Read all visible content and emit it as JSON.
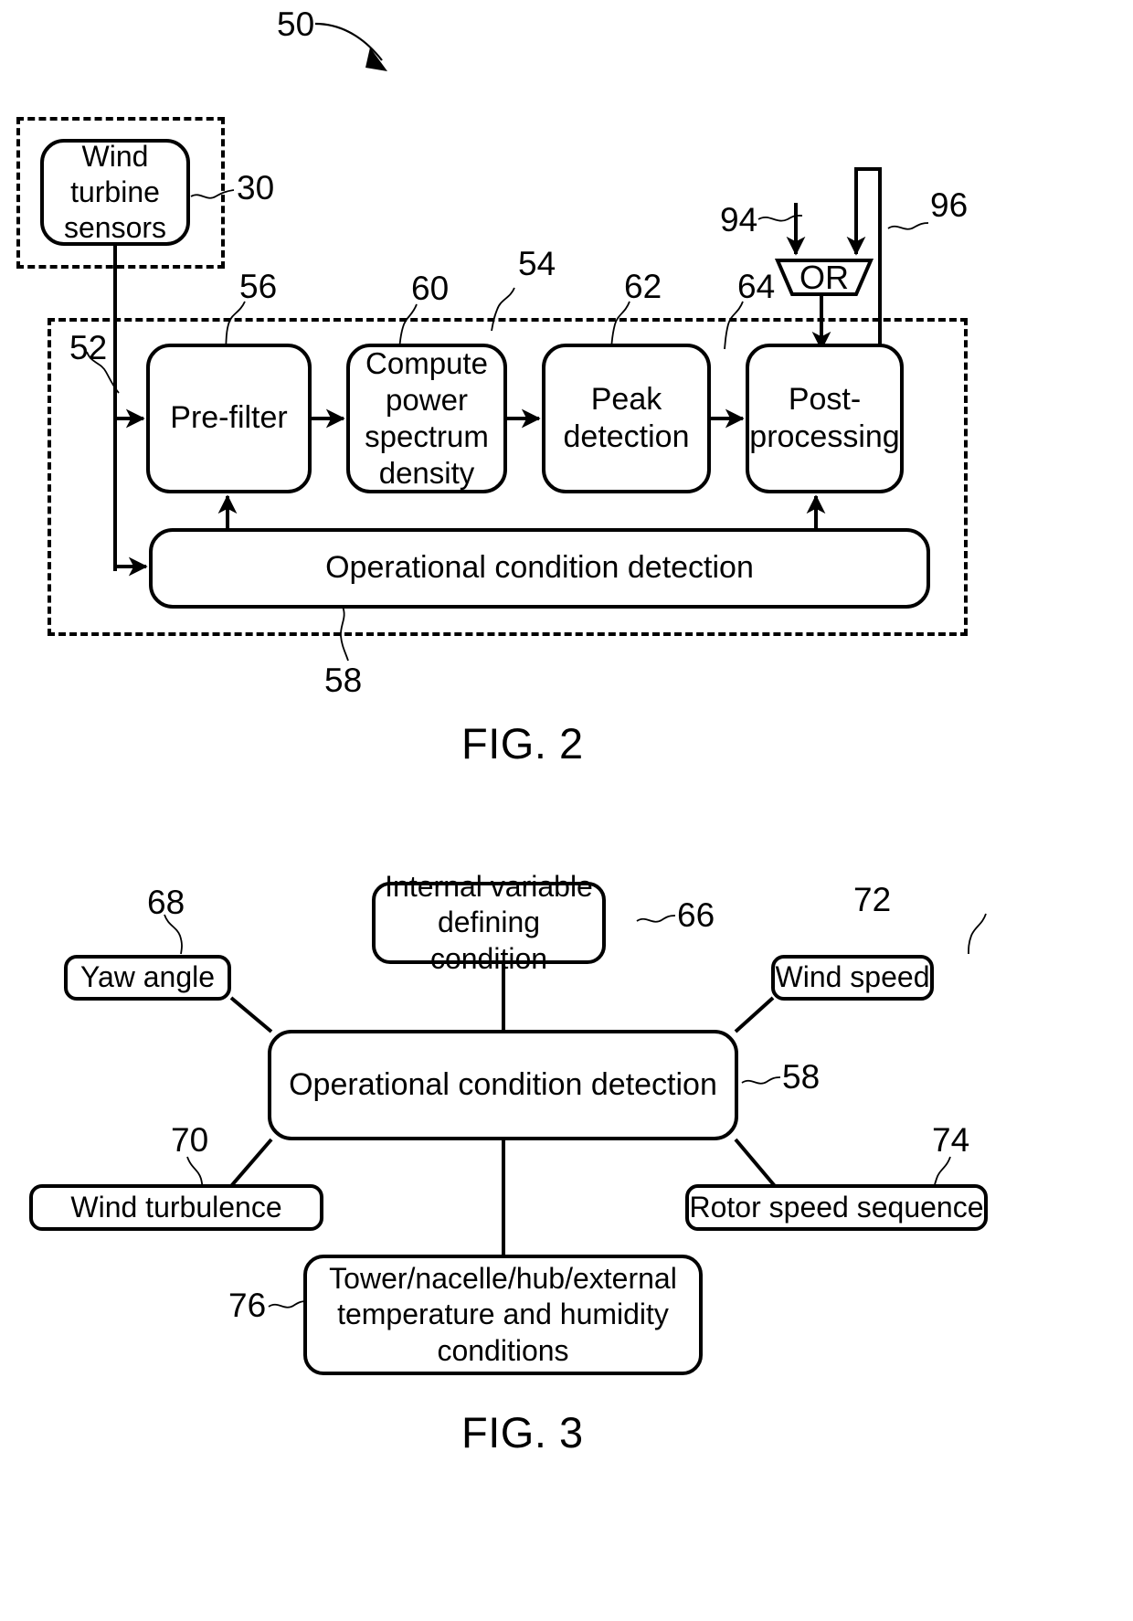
{
  "figures": [
    {
      "id": "fig2",
      "caption": "FIG. 2",
      "system_ref": "50",
      "outer_dashed_ref": "52",
      "inner_dashed_ref": "54",
      "sensor_group": {
        "box_label": "Wind turbine sensors",
        "ref": "30"
      },
      "pipeline": [
        {
          "label": "Pre-filter",
          "ref": "56"
        },
        {
          "label": "Compute power spectrum density",
          "ref": "60"
        },
        {
          "label": "Peak detection",
          "ref": "62"
        },
        {
          "label": "Post-processing",
          "ref": "64"
        }
      ],
      "condition_block": {
        "label": "Operational condition detection",
        "ref": "58"
      },
      "logic_gate": {
        "label": "OR",
        "input_ref": "94",
        "feedback_ref": "96"
      }
    },
    {
      "id": "fig3",
      "caption": "FIG. 3",
      "center": {
        "label": "Operational condition detection",
        "ref": "58"
      },
      "inputs": [
        {
          "label": "Internal variable defining condition",
          "ref": "66",
          "position": "top"
        },
        {
          "label": "Yaw angle",
          "ref": "68",
          "position": "top-left"
        },
        {
          "label": "Wind speed",
          "ref": "72",
          "position": "top-right"
        },
        {
          "label": "Wind turbulence",
          "ref": "70",
          "position": "bottom-left"
        },
        {
          "label": "Rotor speed sequence",
          "ref": "74",
          "position": "bottom-right"
        },
        {
          "label": "Tower/nacelle/hub/external temperature and humidity conditions",
          "ref": "76",
          "position": "bottom"
        }
      ]
    }
  ],
  "fig2": {
    "caption": "FIG. 2",
    "ref_50": "50",
    "ref_30": "30",
    "ref_52": "52",
    "ref_54": "54",
    "ref_56": "56",
    "ref_58": "58",
    "ref_60": "60",
    "ref_62": "62",
    "ref_64": "64",
    "ref_94": "94",
    "ref_96": "96",
    "sensors_label": "Wind turbine sensors",
    "prefilter_label": "Pre-filter",
    "psd_label": "Compute power spectrum density",
    "peak_label": "Peak detection",
    "post_label": "Post-processing",
    "ocd_label": "Operational condition detection",
    "or_label": "OR"
  },
  "fig3": {
    "caption": "FIG. 3",
    "ref_58": "58",
    "ref_66": "66",
    "ref_68": "68",
    "ref_70": "70",
    "ref_72": "72",
    "ref_74": "74",
    "ref_76": "76",
    "ocd_label": "Operational condition detection",
    "internal_var_label": "Internal variable defining condition",
    "yaw_label": "Yaw angle",
    "turbulence_label": "Wind turbulence",
    "windspeed_label": "Wind speed",
    "rotor_label": "Rotor speed sequence",
    "temp_label": "Tower/nacelle/hub/external temperature and humidity conditions"
  },
  "style": {
    "line_color": "#000000",
    "background": "#ffffff"
  }
}
